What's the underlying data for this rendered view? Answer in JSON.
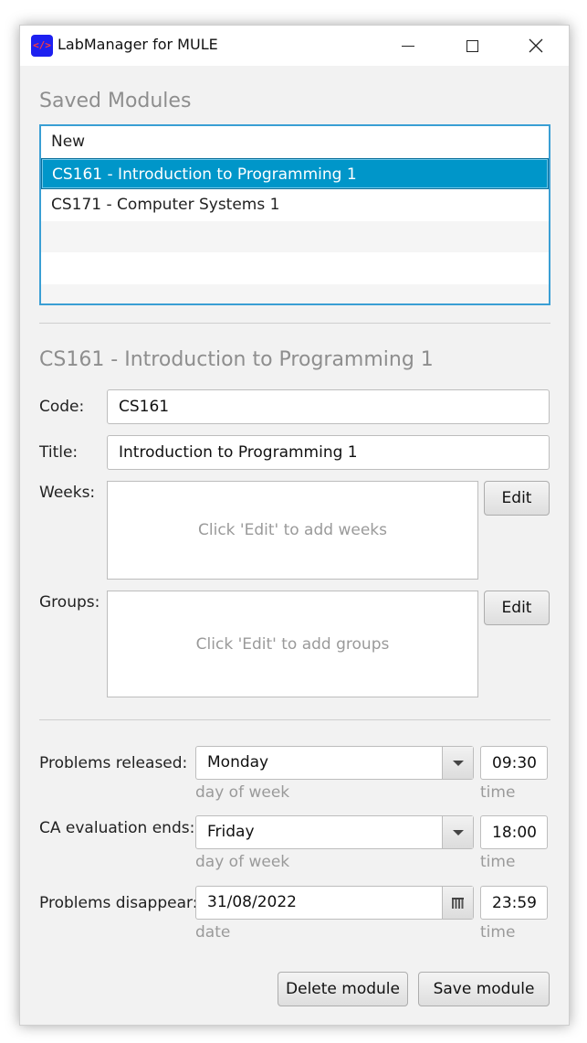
{
  "window": {
    "title": "LabManager for MULE",
    "icon_text": "</>"
  },
  "saved_modules": {
    "heading": "Saved Modules",
    "items": [
      {
        "label": "New"
      },
      {
        "label": "CS161 - Introduction to Programming 1",
        "selected": true
      },
      {
        "label": "CS171 - Computer Systems 1"
      }
    ]
  },
  "module": {
    "heading": "CS161 - Introduction to Programming 1",
    "code_label": "Code:",
    "code_value": "CS161",
    "title_label": "Title:",
    "title_value": "Introduction to Programming 1",
    "weeks_label": "Weeks:",
    "weeks_placeholder": "Click 'Edit' to add weeks",
    "weeks_edit": "Edit",
    "groups_label": "Groups:",
    "groups_placeholder": "Click 'Edit' to add groups",
    "groups_edit": "Edit"
  },
  "schedule": {
    "released": {
      "label": "Problems released:",
      "day": "Monday",
      "day_hint": "day of week",
      "time": "09:30",
      "time_hint": "time"
    },
    "ca_ends": {
      "label": "CA evaluation ends:",
      "day": "Friday",
      "day_hint": "day of week",
      "time": "18:00",
      "time_hint": "time"
    },
    "disappear": {
      "label": "Problems disappear:",
      "date": "31/08/2022",
      "date_hint": "date",
      "time": "23:59",
      "time_hint": "time"
    }
  },
  "actions": {
    "delete": "Delete module",
    "save": "Save module"
  },
  "colors": {
    "accent": "#0096c9",
    "list_border": "#3a9fd4",
    "window_bg": "#f2f2f2"
  }
}
